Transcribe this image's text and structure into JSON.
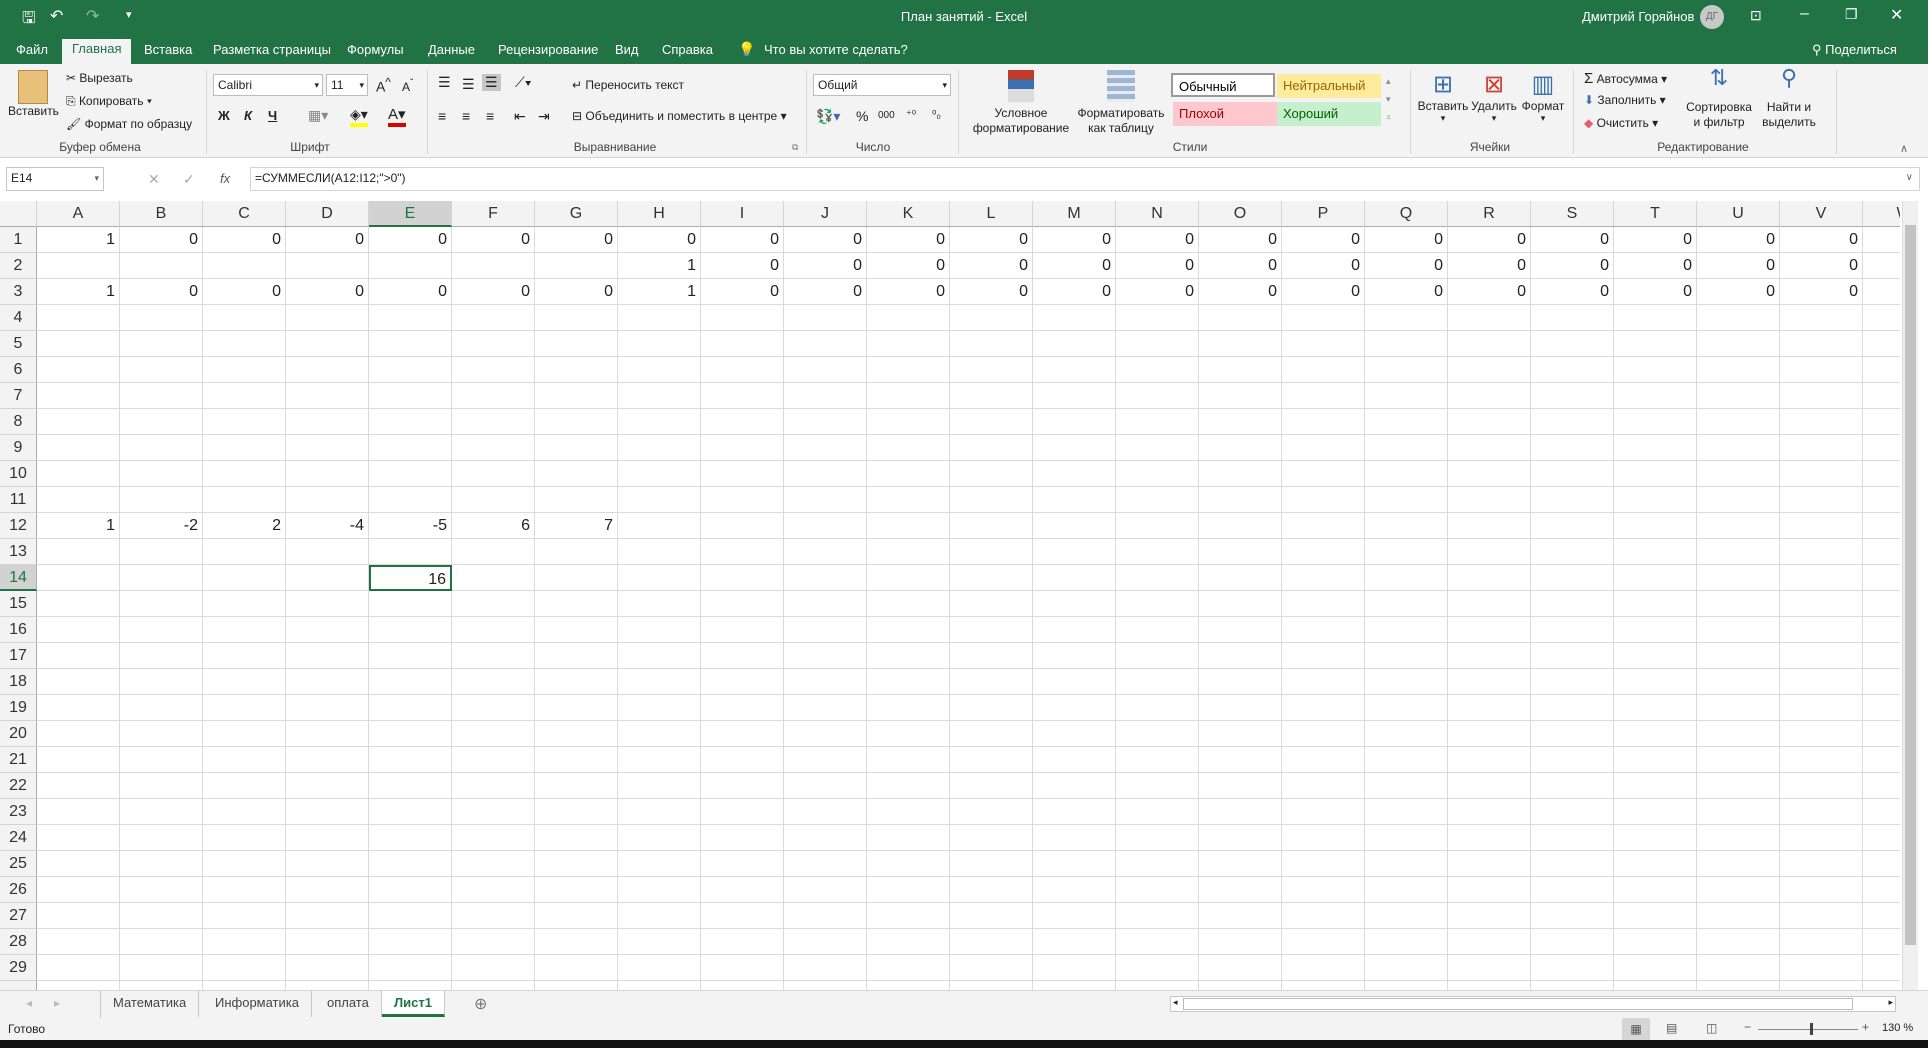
{
  "title_bar": {
    "title": "План занятий  -  Excel",
    "user": "Дмитрий Горяйнов",
    "avatar": "ДГ"
  },
  "ribbon_tabs": [
    {
      "label": "Файл"
    },
    {
      "label": "Главная",
      "active": true
    },
    {
      "label": "Вставка"
    },
    {
      "label": "Разметка страницы"
    },
    {
      "label": "Формулы"
    },
    {
      "label": "Данные"
    },
    {
      "label": "Рецензирование"
    },
    {
      "label": "Вид"
    },
    {
      "label": "Справка"
    }
  ],
  "tell_me": "Что вы хотите сделать?",
  "share": "Поделиться",
  "clipboard": {
    "paste": "Вставить",
    "cut": "Вырезать",
    "copy": "Копировать",
    "format_painter": "Формат по образцу",
    "label": "Буфер обмена"
  },
  "font": {
    "name": "Calibri",
    "size": "11",
    "bold": "Ж",
    "italic": "К",
    "underline": "Ч",
    "label": "Шрифт"
  },
  "alignment": {
    "wrap": "Переносить текст",
    "merge": "Объединить и поместить в центре",
    "label": "Выравнивание"
  },
  "number": {
    "format": "Общий",
    "percent": "%",
    "thousands": "000",
    "label": "Число"
  },
  "styles": {
    "conditional": "Условное форматирование",
    "as_table": "Форматировать как таблицу",
    "normal": "Обычный",
    "neutral": "Нейтральный",
    "bad": "Плохой",
    "good": "Хороший",
    "label": "Стили"
  },
  "cells": {
    "insert": "Вставить",
    "delete": "Удалить",
    "format": "Формат",
    "label": "Ячейки"
  },
  "editing": {
    "autosum": "Автосумма",
    "fill": "Заполнить",
    "clear": "Очистить",
    "sort": "Сортировка и фильтр",
    "find": "Найти и выделить",
    "label": "Редактирование"
  },
  "formula_bar": {
    "name_box": "E14",
    "fx": "fx",
    "formula": "=СУММЕСЛИ(A12:I12;\">0\")"
  },
  "grid": {
    "columns": [
      "A",
      "B",
      "C",
      "D",
      "E",
      "F",
      "G",
      "H",
      "I",
      "J",
      "K",
      "L",
      "M",
      "N",
      "O",
      "P",
      "Q",
      "R",
      "S",
      "T",
      "U",
      "V"
    ],
    "row_count": 29,
    "selected": "E14",
    "cells": {
      "1": [
        "1",
        "0",
        "0",
        "0",
        "0",
        "0",
        "0",
        "0",
        "0",
        "0",
        "0",
        "0",
        "0",
        "0",
        "0",
        "0",
        "0",
        "0",
        "0",
        "0",
        "0",
        "0"
      ],
      "2": [
        "",
        "",
        "",
        "",
        "",
        "",
        "",
        "1",
        "0",
        "0",
        "0",
        "0",
        "0",
        "0",
        "0",
        "0",
        "0",
        "0",
        "0",
        "0",
        "0",
        "0"
      ],
      "3": [
        "1",
        "0",
        "0",
        "0",
        "0",
        "0",
        "0",
        "1",
        "0",
        "0",
        "0",
        "0",
        "0",
        "0",
        "0",
        "0",
        "0",
        "0",
        "0",
        "0",
        "0",
        "0"
      ],
      "12": [
        "1",
        "-2",
        "2",
        "-4",
        "-5",
        "6",
        "7"
      ],
      "14": [
        "",
        "",
        "",
        "",
        "16"
      ]
    }
  },
  "sheets": [
    {
      "label": "Математика"
    },
    {
      "label": "Информатика"
    },
    {
      "label": "оплата"
    },
    {
      "label": "Лист1",
      "active": true
    }
  ],
  "status": {
    "ready": "Готово",
    "zoom": "130 %"
  },
  "colors": {
    "accent": "#217346",
    "neutral": "#ffeb9c",
    "bad": "#ffc7ce",
    "good": "#c6efce"
  }
}
